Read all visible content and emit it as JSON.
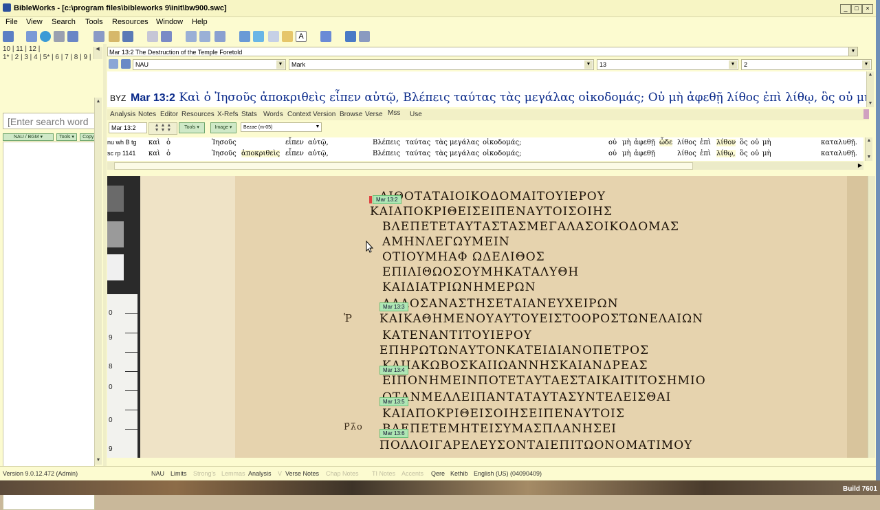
{
  "window": {
    "title": "BibleWorks - [c:\\program files\\bibleworks 9\\init\\bw900.swc]",
    "min_label": "_",
    "max_label": "□",
    "close_label": "×"
  },
  "menu": [
    "File",
    "View",
    "Search",
    "Tools",
    "Resources",
    "Window",
    "Help"
  ],
  "left_pane": {
    "tabs_row1": "10 | 11 | 12 |",
    "tabs_row2": "1* | 2 | 3 | 4 | 5* | 6 | 7 | 8 | 9 |",
    "search_placeholder": "[Enter search word",
    "version_btn": "NAU / BGM ▾",
    "tools_btn": "Tools ▾",
    "copy_btn": "Copy ▾"
  },
  "verse_ref": "Mar 13:2 The Destruction of the Temple Foretold",
  "selectors": {
    "version": "NAU",
    "book": "Mark",
    "chapter": "13",
    "verse": "2"
  },
  "text_window": {
    "version_tag": "BYZ",
    "ref": "Mar 13:2",
    "text": "Καὶ ὁ Ἰησοῦς ἀποκριθεὶς εἶπεν αὐτῷ, Βλέπεις ταύτας τὰς μεγάλας οἰκοδομάς; Οὐ μὴ ἀφεθῇ λίθος ἐπὶ λίθῳ, ὃς οὐ μὴ"
  },
  "analysis_tabs": [
    "Analysis",
    "Notes",
    "Editor",
    "Resources",
    "X-Refs",
    "Stats",
    "Words",
    "Context",
    "Version",
    "Browse",
    "Verse",
    "Mss",
    "Use"
  ],
  "mss_bar": {
    "ref_input": "Mar 13:2",
    "tools_btn": "Tools ▾",
    "image_btn": "Image ▾",
    "manuscript": "Bezae (m-05)"
  },
  "mss_rows": [
    {
      "sig": "nu wh B tg",
      "words": [
        "καὶ",
        "ὁ",
        "Ἰησοῦς",
        "εἶπεν",
        "αὐτῷ,",
        "Βλέπεις",
        "ταύτας",
        "τὰς",
        "μεγάλας",
        "οἰκοδομάς;",
        "οὐ",
        "μὴ",
        "ἀφεθῇ",
        "ὧδε",
        "λίθος",
        "ἐπὶ",
        "λίθον",
        "ὃς",
        "οὐ",
        "μὴ",
        "καταλυθῇ."
      ]
    },
    {
      "sig": "sc rp 1141",
      "words": [
        "καὶ",
        "ὁ",
        "Ἰησοῦς",
        "ἀποκριθεὶς",
        "εἶπεν",
        "αὐτῷ,",
        "Βλέπεις",
        "ταύτας",
        "τὰς",
        "μεγάλας",
        "οἰκοδομάς;",
        "οὐ",
        "μὴ",
        "ἀφεθῇ",
        "λίθος",
        "ἐπὶ",
        "λίθῳ,",
        "ὃς",
        "οὐ",
        "μὴ",
        "καταλυθῇ."
      ]
    }
  ],
  "manuscript_image": {
    "ruler_numbers": [
      "0",
      "9",
      "8",
      "0",
      "0",
      "9"
    ],
    "verse_tags": [
      "Mar 13:2",
      "Mar 13:3",
      "Mar 13:4",
      "Mar 13:5",
      "Mar 13:6"
    ],
    "lines": [
      "ΛΙΘΟΤΑΤΑΙΟΙΚΟΔΟΜΑΙΤΟΥΙΕΡΟΥ",
      "ΚΑΙΑΠΟΚΡΙΘΕΙΣΕΙΠΕΝΑΥΤΟΙΣΟΙΗΣ",
      "ΒΛΕΠΕΤΕΤΑΥΤΑΣΤΑΣΜΕΓΑΛΑΣΟΙΚΟΔΟΜΑΣ",
      "ΑΜΗΝΛΕΓΩΥΜΕΙΝ",
      "ΟΤΙΟΥΜΗΑΦ    ΩΔΕΛΙΘΟΣ",
      "ΕΠΙΛΙΘΩΟΣΟΥΜΗΚΑΤΑΛΥΘΗ",
      "ΚΑΙΔΙΑΤΡΙΩΝΗΜΕΡΩΝ",
      "ΑΛΛΟΣΑΝΑΣΤΗΣΕΤΑΙΑΝΕΥΧΕΙΡΩΝ",
      "ΚΑΙΚΑΘΗΜΕΝΟΥΑΥΤΟΥΕΙΣΤΟΟΡΟΣΤΩΝΕΛΑΙΩΝ",
      "ΚΑΤΕΝΑΝΤΙΤΟΥΙΕΡΟΥ",
      "ΕΠΗΡΩΤΩΝΑΥΤΟΝΚΑΤΕΙΔΙΑΝΟΠΕΤΡΟΣ",
      "ΚΑΙΙΑΚΩΒΟΣΚΑΙΙΩΑΝΝΗΣΚΑΙΑΝΔΡΕΑΣ",
      "ΕΙΠΟΝΗΜΕΙΝΠΟΤΕΤΑΥΤΑΕΣΤΑΙΚΑΙΤΙΤΟΣΗΜΙΟ",
      "ΟΤΑΝΜΕΛΛΕΙΠΑΝΤΑΤΑΥΤΑΣΥΝΤΕΛΕΙΣΘΑΙ",
      "ΚΑΙΑΠΟΚΡΙΘΕΙΣΟΙΗΣΕΙΠΕΝΑΥΤΟΙΣ",
      "ΒΛΕΠΕΤΕΜΗΤΕΙΣΥΜΑΣΠΛΑΝΗΣΕΙ",
      "ΠΟΛΛΟΙΓΑΡΕΛΕΥΣΟΝΤΑΙΕΠΙΤΩΟΝΟΜΑΤΙΜΟΥ"
    ],
    "margin_marks": [
      "Ῥ",
      "Ρ̄λ̄ο"
    ]
  },
  "status_bar": {
    "version": "Version 9.0.12.472 (Admin)",
    "items": [
      "NAU",
      "Limits",
      "Strong's",
      "Lemmas",
      "Analysis",
      "V",
      "Verse Notes",
      "Chap Notes",
      "TI Notes",
      "Accents",
      "Qere",
      "Kethib",
      "English (US)  (04090409)"
    ],
    "dim": [
      false,
      false,
      true,
      true,
      false,
      true,
      false,
      true,
      true,
      true,
      false,
      false,
      false
    ]
  },
  "build": "Build 7601"
}
